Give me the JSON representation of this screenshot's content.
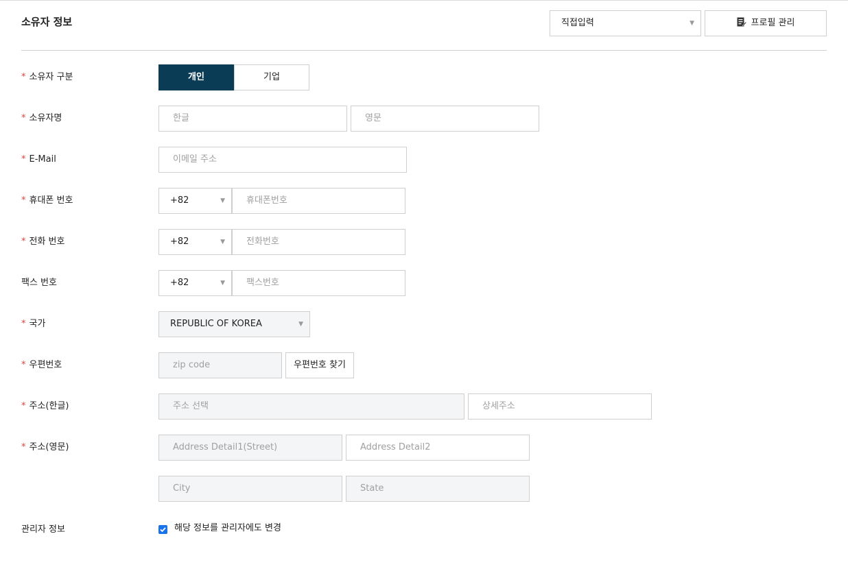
{
  "section": {
    "title": "소유자 정보"
  },
  "header": {
    "input_mode_select": "직접입력",
    "profile_button": "프로필 관리"
  },
  "fields": {
    "owner_type": {
      "label": "소유자 구분",
      "required_mark": "*",
      "options": [
        "개인",
        "기업"
      ],
      "selected": "개인"
    },
    "owner_name": {
      "label": "소유자명",
      "required_mark": "*",
      "korean_placeholder": "한글",
      "english_placeholder": "영문"
    },
    "email": {
      "label": "E-Mail",
      "required_mark": "*",
      "placeholder": "이메일 주소"
    },
    "mobile": {
      "label": "휴대폰 번호",
      "required_mark": "*",
      "country_code": "+82",
      "placeholder": "휴대폰번호"
    },
    "phone": {
      "label": "전화 번호",
      "required_mark": "*",
      "country_code": "+82",
      "placeholder": "전화번호"
    },
    "fax": {
      "label": "팩스 번호",
      "country_code": "+82",
      "placeholder": "팩스번호"
    },
    "country": {
      "label": "국가",
      "required_mark": "*",
      "value": "REPUBLIC OF KOREA"
    },
    "zip": {
      "label": "우편번호",
      "required_mark": "*",
      "placeholder": "zip code",
      "search_button": "우편번호 찾기"
    },
    "address_kr": {
      "label": "주소(한글)",
      "required_mark": "*",
      "select_placeholder": "주소 선택",
      "detail_placeholder": "상세주소"
    },
    "address_en": {
      "label": "주소(영문)",
      "required_mark": "*",
      "street_placeholder": "Address Detail1(Street)",
      "detail2_placeholder": "Address Detail2",
      "city_placeholder": "City",
      "state_placeholder": "State"
    },
    "admin_info": {
      "label": "관리자 정보",
      "checkbox_label": "해당 정보를 관리자에도 변경",
      "checked": true
    }
  },
  "icons": {
    "profile": "edit-document-icon",
    "caret": "caret-down-icon",
    "check": "checkmark-icon"
  },
  "colors": {
    "active_toggle": "#0b3c55",
    "required": "#e0433c",
    "checkbox": "#1a73e8"
  }
}
